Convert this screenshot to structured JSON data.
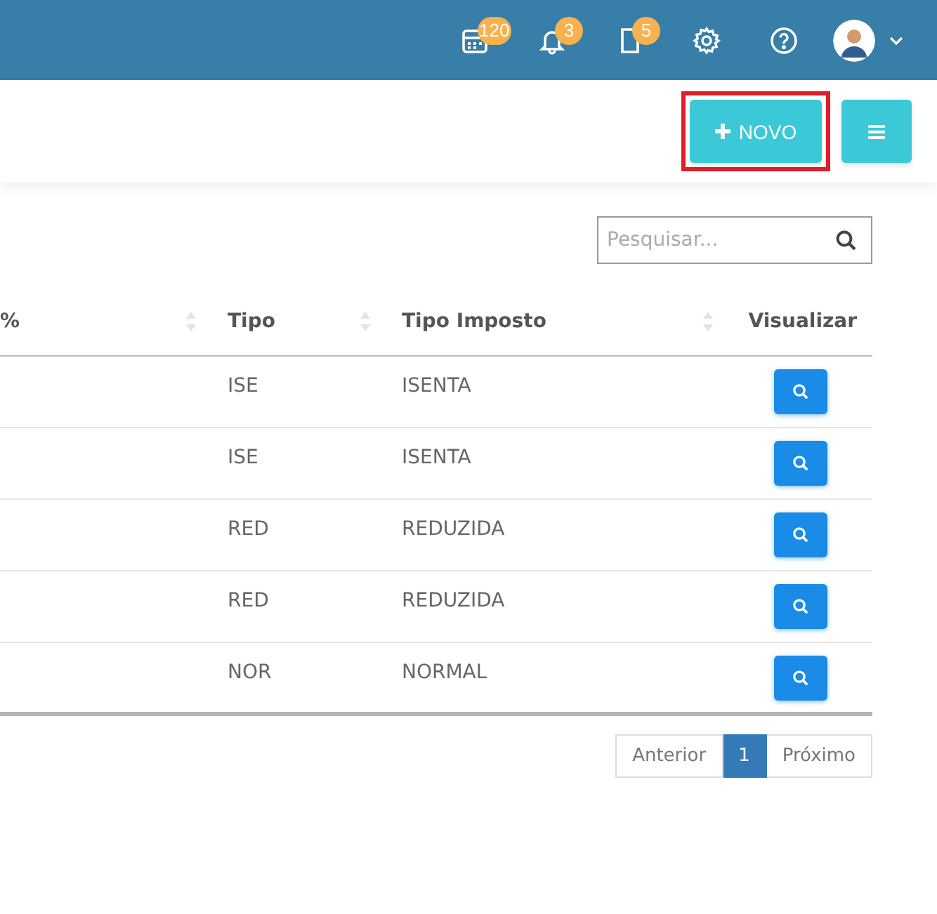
{
  "header": {
    "icons": [
      {
        "kind": "calendar",
        "badge": "120"
      },
      {
        "kind": "bell",
        "badge": "3"
      },
      {
        "kind": "document",
        "badge": "5"
      },
      {
        "kind": "settings"
      },
      {
        "kind": "help"
      }
    ],
    "user_menu": {
      "kind": "avatar"
    }
  },
  "toolbar": {
    "buttons": [
      {
        "kind": "new",
        "label": "NOVO",
        "highlighted": true
      },
      {
        "kind": "menu",
        "highlighted": false
      }
    ]
  },
  "search": {
    "placeholder": "Pesquisar..."
  },
  "table": {
    "columns": [
      {
        "label": "%",
        "sortable": true
      },
      {
        "label": "Tipo",
        "sortable": true
      },
      {
        "label": "Tipo Imposto",
        "sortable": true
      },
      {
        "label": "Visualizar",
        "sortable": false
      }
    ],
    "rows": [
      {
        "tipo": "ISE",
        "tipo_imposto": "ISENTA"
      },
      {
        "tipo": "ISE",
        "tipo_imposto": "ISENTA"
      },
      {
        "tipo": "RED",
        "tipo_imposto": "REDUZIDA"
      },
      {
        "tipo": "RED",
        "tipo_imposto": "REDUZIDA"
      },
      {
        "tipo": "NOR",
        "tipo_imposto": "NORMAL"
      }
    ]
  },
  "pagination": {
    "previous": "Anterior",
    "pages": [
      {
        "label": "1",
        "selected": true
      }
    ],
    "next": "Próximo"
  }
}
